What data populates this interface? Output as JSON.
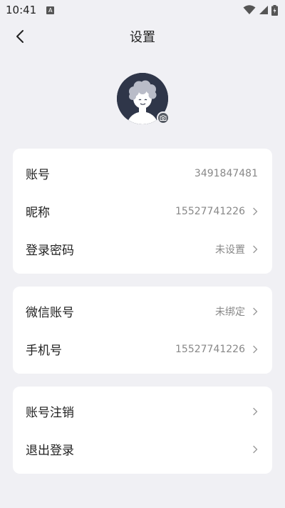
{
  "status_bar": {
    "time": "10:41",
    "app_icon_letter": "A",
    "icons": [
      "wifi-icon",
      "signal-icon",
      "battery-icon"
    ]
  },
  "header": {
    "title": "设置",
    "back_icon": "chevron-left-icon"
  },
  "profile": {
    "avatar_icon": "avatar-illustration",
    "camera_icon": "camera-icon"
  },
  "account_card": {
    "rows": [
      {
        "label": "账号",
        "value": "3491847481",
        "chevron": false
      },
      {
        "label": "昵称",
        "value": "15527741226",
        "chevron": true
      },
      {
        "label": "登录密码",
        "value": "未设置",
        "chevron": true
      }
    ]
  },
  "binding_card": {
    "rows": [
      {
        "label": "微信账号",
        "value": "未绑定",
        "chevron": true
      },
      {
        "label": "手机号",
        "value": "15527741226",
        "chevron": true
      }
    ]
  },
  "actions_card": {
    "rows": [
      {
        "label": "账号注销",
        "chevron": true
      },
      {
        "label": "退出登录",
        "chevron": true
      }
    ]
  },
  "colors": {
    "background": "#f0f0f4",
    "card": "#ffffff",
    "text_primary": "#222222",
    "text_secondary": "#888888",
    "avatar_bg": "#2f3649"
  }
}
